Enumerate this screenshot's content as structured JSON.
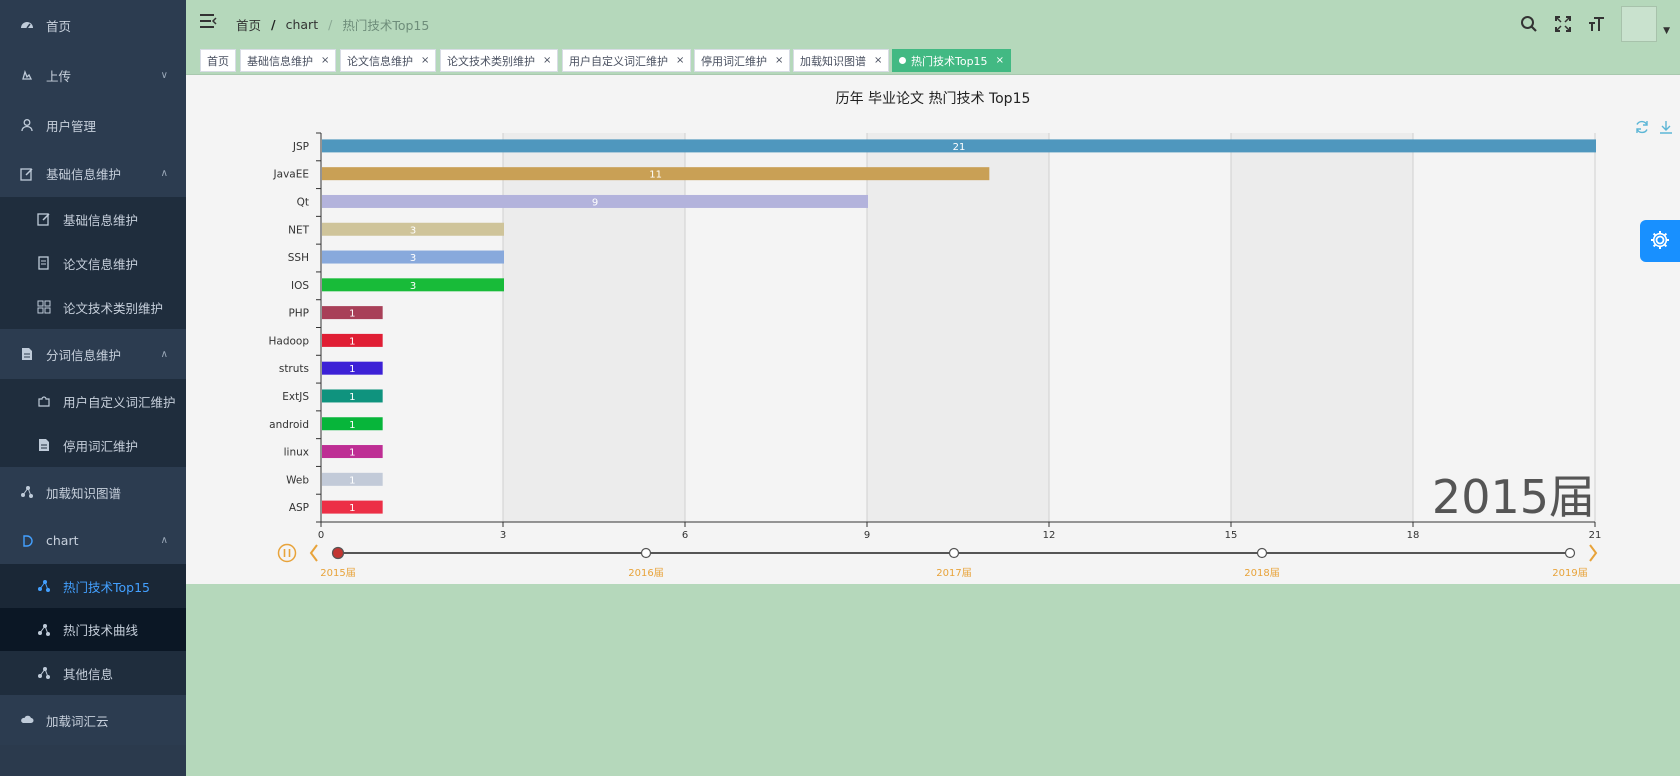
{
  "sidebar": {
    "items": [
      {
        "label": "首页",
        "icon": "dashboard-icon"
      },
      {
        "label": "上传",
        "icon": "upload-icon"
      },
      {
        "label": "用户管理",
        "icon": "user-icon"
      },
      {
        "label": "基础信息维护",
        "icon": "edit-icon"
      },
      {
        "label": "基础信息维护",
        "icon": "edit-icon"
      },
      {
        "label": "论文信息维护",
        "icon": "form-icon"
      },
      {
        "label": "论文技术类别维护",
        "icon": "grid-icon"
      },
      {
        "label": "分词信息维护",
        "icon": "document-icon"
      },
      {
        "label": "用户自定义词汇维护",
        "icon": "puzzle-icon"
      },
      {
        "label": "停用词汇维护",
        "icon": "document-icon"
      },
      {
        "label": "加载知识图谱",
        "icon": "share-icon"
      },
      {
        "label": "chart",
        "icon": "chart-icon"
      },
      {
        "label": "热门技术Top15",
        "icon": "share-icon"
      },
      {
        "label": "热门技术曲线",
        "icon": "share-icon"
      },
      {
        "label": "其他信息",
        "icon": "share-icon"
      },
      {
        "label": "加载词汇云",
        "icon": "cloud-icon"
      }
    ]
  },
  "header": {
    "breadcrumb": [
      "首页",
      "chart",
      "热门技术Top15"
    ],
    "separator": "/"
  },
  "tags": [
    {
      "label": "首页",
      "closable": false
    },
    {
      "label": "基础信息维护",
      "closable": true
    },
    {
      "label": "论文信息维护",
      "closable": true
    },
    {
      "label": "论文技术类别维护",
      "closable": true
    },
    {
      "label": "用户自定义词汇维护",
      "closable": true
    },
    {
      "label": "停用词汇维护",
      "closable": true
    },
    {
      "label": "加载知识图谱",
      "closable": true
    },
    {
      "label": "热门技术Top15",
      "closable": true,
      "active": true
    }
  ],
  "tag_close": "×",
  "chart_data": {
    "type": "bar",
    "orientation": "horizontal",
    "title": "历年 毕业论文 热门技术 Top15",
    "categories": [
      "JSP",
      "JavaEE",
      "Qt",
      "NET",
      "SSH",
      "IOS",
      "PHP",
      "Hadoop",
      "struts",
      "ExtJS",
      "android",
      "linux",
      "Web",
      "ASP"
    ],
    "values": [
      21,
      11,
      9,
      3,
      3,
      3,
      1,
      1,
      1,
      1,
      1,
      1,
      1,
      1
    ],
    "colors": [
      "#4f97be",
      "#c9a055",
      "#b3b3dc",
      "#cfc49a",
      "#88a9dc",
      "#18bb39",
      "#a84058",
      "#e01e34",
      "#3c21d6",
      "#0f937e",
      "#07b53a",
      "#be2e94",
      "#c2cad8",
      "#ec2f46"
    ],
    "xlim": [
      0,
      21
    ],
    "xticks": [
      0,
      3,
      6,
      9,
      12,
      15,
      18,
      21
    ],
    "grid": true,
    "current_period": "2015届",
    "timeline": [
      "2015届",
      "2016届",
      "2017届",
      "2018届",
      "2019届"
    ],
    "timeline_active_index": 0
  },
  "colors": {
    "sidebar_bg": "#2b3a4d",
    "accent": "#42b983",
    "link_active": "#43a0ff",
    "timeline": "#e8a33a",
    "fab": "#1890ff"
  }
}
